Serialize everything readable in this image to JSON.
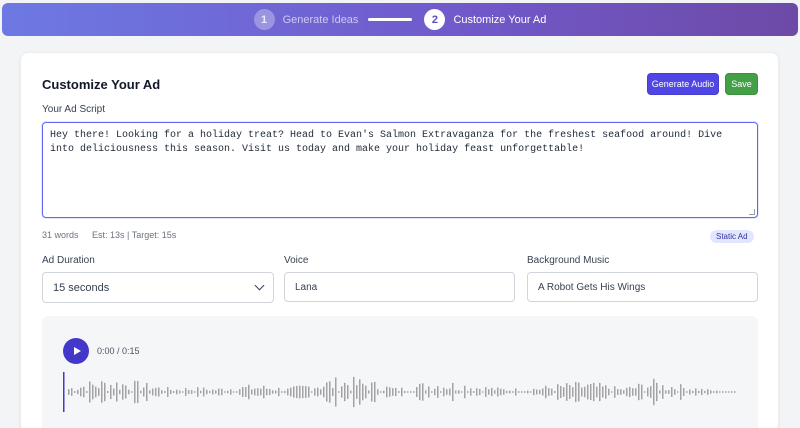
{
  "stepper": {
    "steps": [
      {
        "number": "1",
        "label": "Generate Ideas"
      },
      {
        "number": "2",
        "label": "Customize Your Ad"
      }
    ]
  },
  "header": {
    "title": "Customize Your Ad",
    "generate_audio_label": "Generate Audio",
    "save_label": "Save"
  },
  "script": {
    "label": "Your Ad Script",
    "text": "Hey there! Looking for a holiday treat? Head to Evan's Salmon Extravaganza for the freshest seafood around! Dive into deliciousness this season. Visit us today and make your holiday feast unforgettable!",
    "word_count": "31 words",
    "estimate": "Est: 13s | Target: 15s",
    "badge": "Static Ad"
  },
  "settings": {
    "duration_label": "Ad Duration",
    "duration_value": "15 seconds",
    "voice_label": "Voice",
    "voice_value": "Lana",
    "music_label": "Background Music",
    "music_value": "A Robot Gets His Wings"
  },
  "player": {
    "time": "0:00 / 0:15",
    "progress": 0
  },
  "colors": {
    "accent": "#4f46e5",
    "save": "#43a047",
    "badge_bg": "#e0e7ff"
  }
}
